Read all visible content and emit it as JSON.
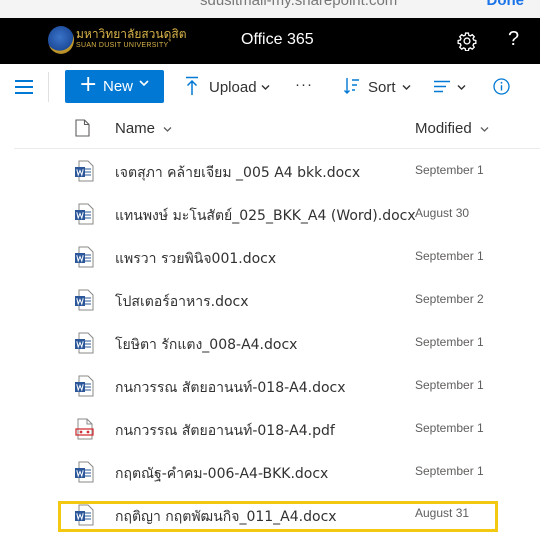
{
  "browser": {
    "url_partial": "sdusitmail-my.sharepoint.com",
    "done_label": "Done"
  },
  "suite": {
    "logo_thai": "มหาวิทยาลัยสวนดุสิต",
    "logo_eng": "SUAN DUSIT UNIVERSITY",
    "app_title": "Office 365",
    "help_glyph": "?"
  },
  "toolbar": {
    "new_label": "New",
    "upload_label": "Upload",
    "more_glyph": "···",
    "sort_label": "Sort"
  },
  "columns": {
    "name": "Name",
    "modified": "Modified"
  },
  "files": [
    {
      "name": "เจตสุภา คล้ายเจียม _005 A4 bkk.docx",
      "modified": "September 1",
      "type": "word"
    },
    {
      "name": "แทนพงษ์ มะโนสัตย์_025_BKK_A4 (Word).docx",
      "modified": "August 30",
      "type": "word"
    },
    {
      "name": "แพรวา รวยพินิจ001.docx",
      "modified": "September 1",
      "type": "word"
    },
    {
      "name": "โปสเตอร์อาหาร.docx",
      "modified": "September 2",
      "type": "word"
    },
    {
      "name": "โยษิตา รักแตง_008-A4.docx",
      "modified": "September 1",
      "type": "word"
    },
    {
      "name": "กนกวรรณ สัตยอานนท์-018-A4.docx",
      "modified": "September 1",
      "type": "word"
    },
    {
      "name": "กนกวรรณ สัตยอานนท์-018-A4.pdf",
      "modified": "September 1",
      "type": "pdf"
    },
    {
      "name": "กฤตณัฐ-คำคม-006-A4-BKK.docx",
      "modified": "September 1",
      "type": "word"
    },
    {
      "name": "กฤติญา กฤตพัฒนกิจ_011_A4.docx",
      "modified": "August 31",
      "type": "word"
    }
  ],
  "colors": {
    "accent": "#0078d4",
    "highlight": "#f2c811",
    "suite_bar": "#000000"
  }
}
